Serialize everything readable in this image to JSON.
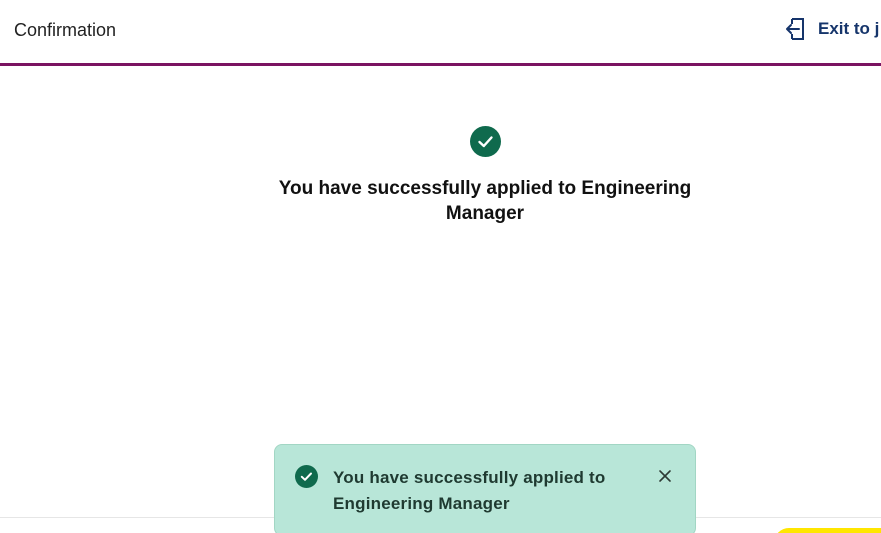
{
  "header": {
    "title": "Confirmation",
    "exit_label": "Exit to j",
    "exit_icon": "exit-icon",
    "accent_color": "#7a1361"
  },
  "main": {
    "status_icon": "check-circle-icon",
    "message": "You have successfully applied to Engineering Manager",
    "success_color": "#0f6a4d"
  },
  "toast": {
    "icon": "check-circle-icon",
    "message": "You have successfully applied to Engineering Manager",
    "close_icon": "close-icon",
    "background_color": "#b8e6d8"
  },
  "footer": {
    "button_color": "#ffe600"
  }
}
